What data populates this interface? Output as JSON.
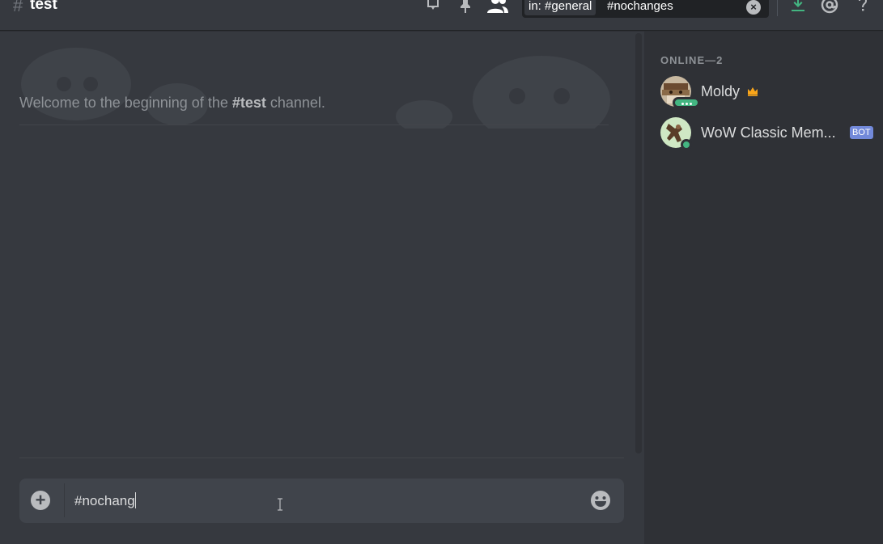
{
  "header": {
    "hash": "#",
    "channel": "test",
    "icons": [
      "notification-bell-icon",
      "pin-icon",
      "members-icon",
      "inbox-download-icon",
      "mention-icon",
      "help-icon"
    ],
    "search": {
      "filter_chip": "in: #general",
      "query": "#nochanges",
      "clear_icon": "clear-circle-icon"
    }
  },
  "chat": {
    "welcome_prefix": "Welcome to the beginning of the ",
    "welcome_channel": "#test",
    "welcome_suffix": " channel.",
    "composer": {
      "value": "#nochang",
      "plus_icon": "add-attachment-icon",
      "emoji_icon": "emoji-picker-icon"
    }
  },
  "members": {
    "group_label": "ONLINE—2",
    "list": [
      {
        "name": "Moldy",
        "badge_icon": "crown-icon",
        "status": "typing",
        "status_color": "#43b581"
      },
      {
        "name": "WoW Classic Mem...",
        "tag": "BOT",
        "status": "online",
        "status_color": "#43b581"
      }
    ]
  },
  "colors": {
    "background": "#36393f",
    "sidebar": "#2f3136",
    "input": "#40444b",
    "online": "#43b581",
    "bot_tag": "#7289da",
    "download_green": "#43b581",
    "crown": "#faa61a"
  }
}
